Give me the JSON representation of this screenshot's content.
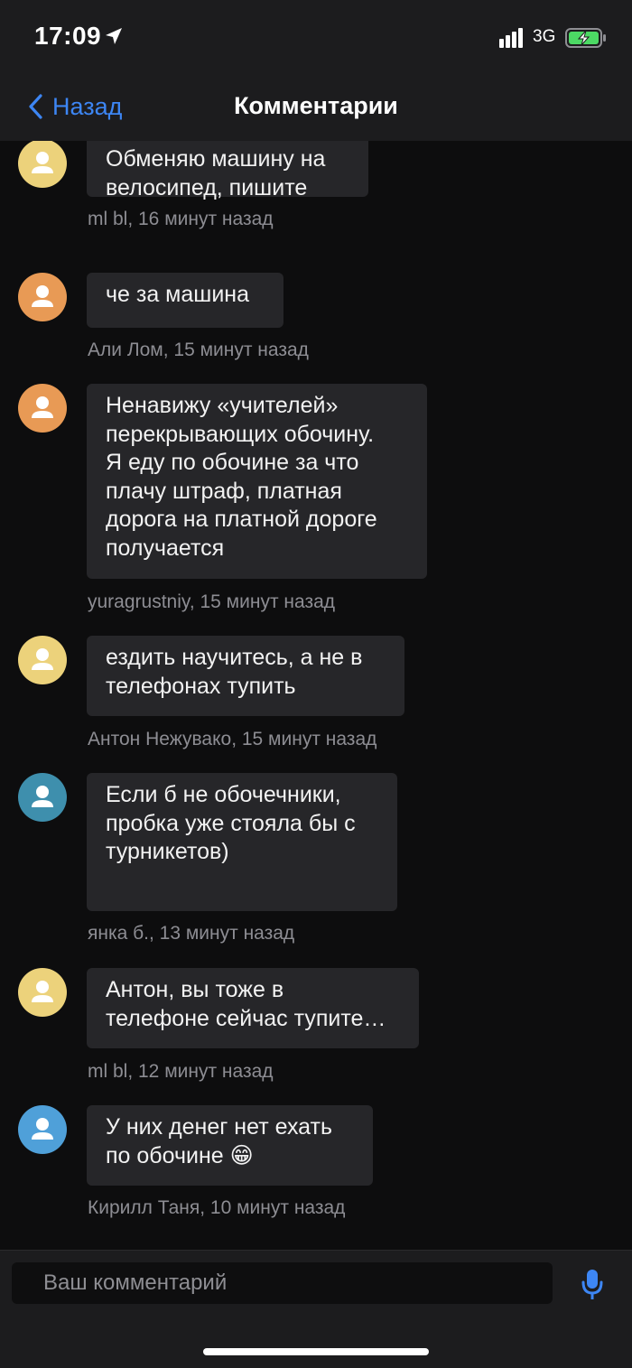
{
  "status_bar": {
    "time": "17:09",
    "network": "3G"
  },
  "nav": {
    "back_label": "Назад",
    "title": "Комментарии"
  },
  "colors": {
    "accent": "#3d86f4",
    "avatar_yellow": "#ecd27b",
    "avatar_orange": "#e89a55",
    "avatar_teal": "#3e8fad",
    "avatar_blue": "#4fa0d9"
  },
  "comments": [
    {
      "lines": [
        "Обменяю машину на",
        "велосипед, пишите"
      ],
      "meta": "ml bl, 16 минут назад",
      "avatar_color": "yellow"
    },
    {
      "lines": [
        "че за машина"
      ],
      "meta": "Али Лом, 15 минут назад",
      "avatar_color": "orange"
    },
    {
      "lines": [
        "Ненавижу «учителей»",
        "перекрывающих обочину.",
        "Я еду по обочине за что",
        "плачу штраф, платная",
        "дорога на платной дороге",
        "получается"
      ],
      "meta": "yuragrustniy, 15 минут назад",
      "avatar_color": "orange"
    },
    {
      "lines": [
        "ездить научитесь, а не в",
        "телефонах тупить"
      ],
      "meta": "Антон Нежувако, 15 минут назад",
      "avatar_color": "yellow"
    },
    {
      "lines": [
        "Если б не обочечники,",
        "пробка уже стояла бы с",
        "турникетов)"
      ],
      "meta": "янка б., 13 минут назад",
      "avatar_color": "teal"
    },
    {
      "lines": [
        "Антон, вы тоже в",
        "телефоне сейчас тупите…"
      ],
      "meta": "ml bl, 12 минут назад",
      "avatar_color": "yellow"
    },
    {
      "lines": [
        "У них денег нет ехать",
        "по обочине 😁"
      ],
      "meta": "Кирилл Таня, 10 минут назад",
      "avatar_color": "blue"
    }
  ],
  "input": {
    "placeholder": "Ваш комментарий"
  },
  "icons": {
    "back": "chevron-left-icon",
    "mic": "microphone-icon",
    "location": "location-arrow-icon",
    "signal": "signal-bars-icon",
    "battery": "battery-charging-icon"
  }
}
